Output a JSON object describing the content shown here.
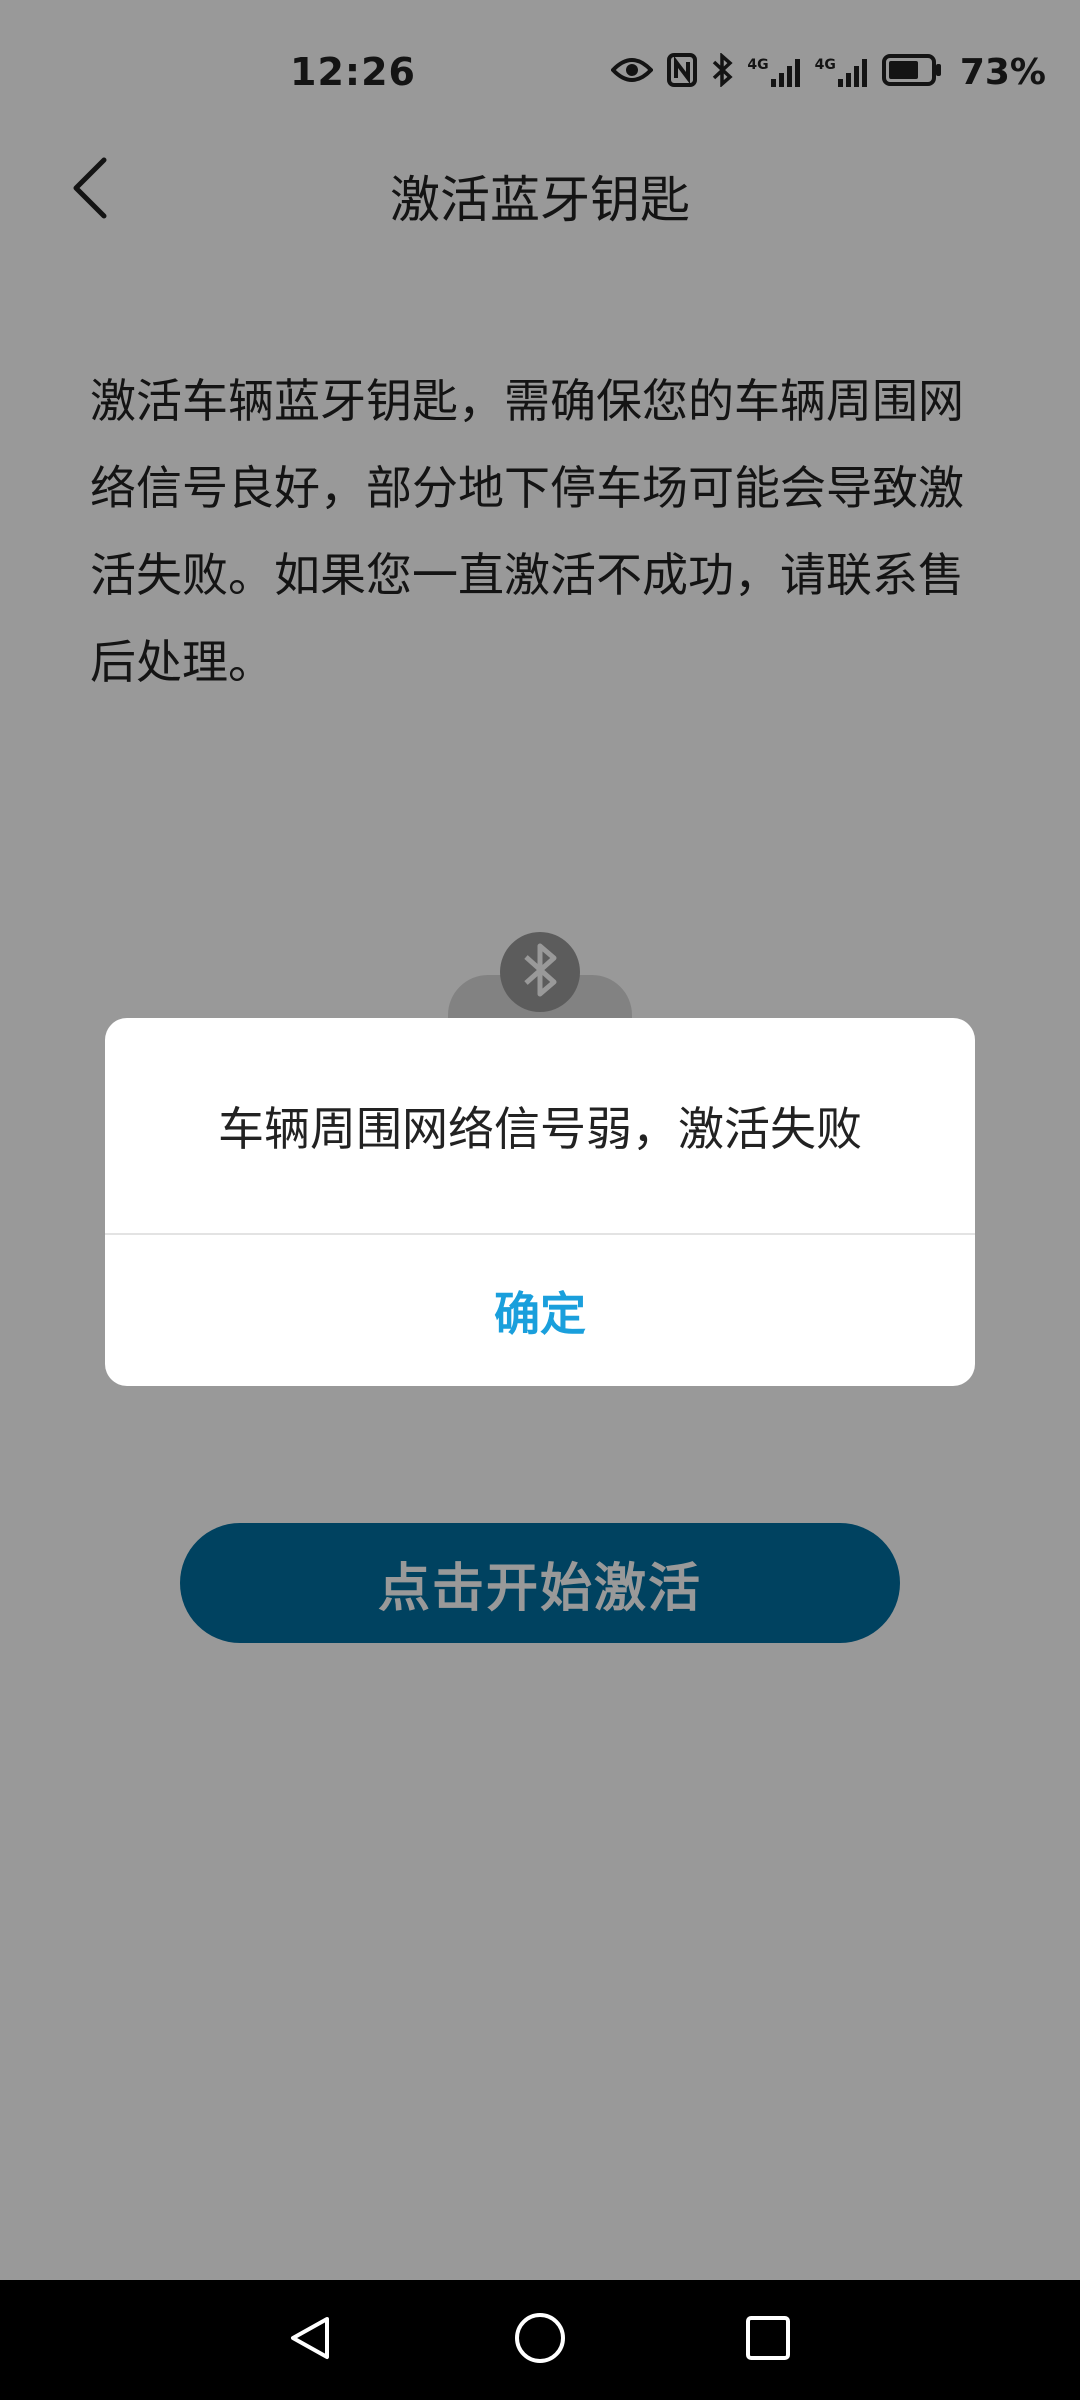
{
  "status_bar": {
    "time": "12:26",
    "network_1": "4G",
    "network_2": "4G",
    "battery_percent_text": "73%",
    "battery_level": 0.73
  },
  "header": {
    "title": "激活蓝牙钥匙"
  },
  "description": "激活车辆蓝牙钥匙，需确保您的车辆周围网络信号良好，部分地下停车场可能会导致激活失败。如果您一直激活不成功，请联系售后处理。",
  "start_button": {
    "label": "点击开始激活",
    "color": "#016fa1"
  },
  "dialog": {
    "message": "车辆周围网络信号弱，激活失败",
    "confirm_label": "确定",
    "confirm_color": "#1a9fdc"
  },
  "icons": {
    "back": "chevron-left-icon",
    "bluetooth": "bluetooth-icon",
    "eye": "eye-icon",
    "nfc": "nfc-icon",
    "nav_back": "triangle-back-icon",
    "nav_home": "circle-home-icon",
    "nav_recent": "square-recent-icon"
  }
}
